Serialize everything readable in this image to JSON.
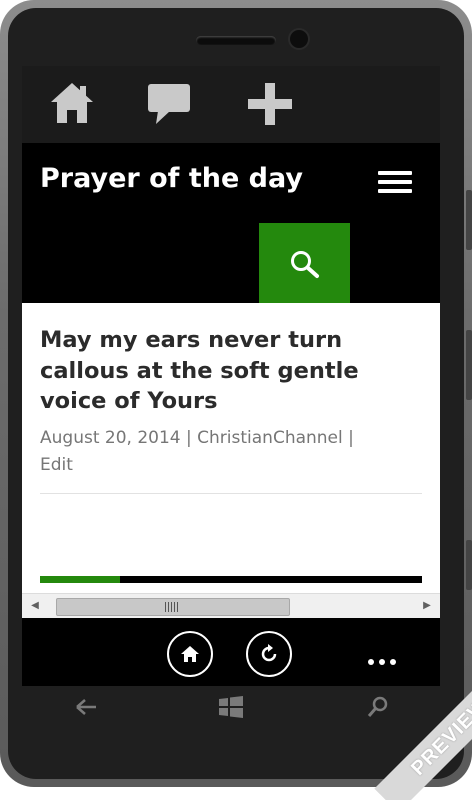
{
  "appbar": {
    "icons": [
      "home-icon",
      "comment-icon",
      "plus-icon"
    ]
  },
  "header": {
    "site_title": "Prayer of the day",
    "menu_icon": "hamburger-icon",
    "search_icon": "search-icon"
  },
  "post": {
    "title": "May my ears never turn callous at the soft gentle voice of Yours",
    "date": "August 20, 2014",
    "separator": "|",
    "author": "ChristianChannel",
    "edit": "Edit"
  },
  "progress": {
    "fraction": 0.21
  },
  "scrollbar": {
    "left_arrow": "◀",
    "right_arrow": "▶"
  },
  "bottombar": {
    "buttons": [
      "home-icon",
      "refresh-icon"
    ],
    "more_icon": "ellipsis-icon"
  },
  "hardware": {
    "buttons": [
      "back-icon",
      "windows-icon",
      "search-icon"
    ]
  },
  "ribbon": {
    "label": "PREVIEW"
  },
  "colors": {
    "accent": "#24890d",
    "header_bg": "#000000",
    "appbar_bg": "#1b1b1b",
    "title_text": "#2b2b2b",
    "meta_text": "#767676"
  }
}
